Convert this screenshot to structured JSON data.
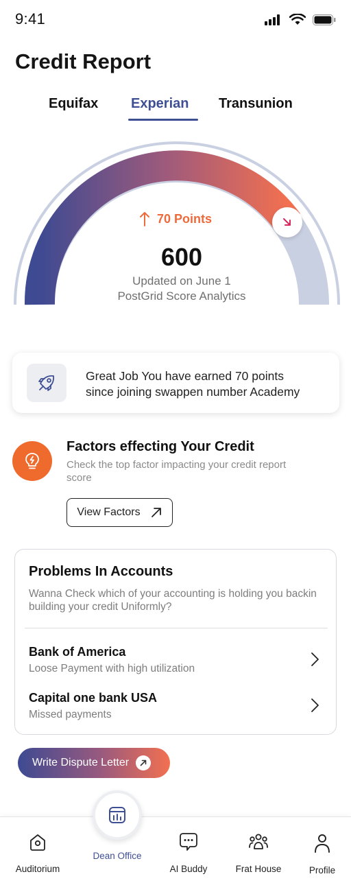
{
  "status_bar": {
    "time": "9:41"
  },
  "header": {
    "title": "Credit Report"
  },
  "tabs": [
    {
      "label": "Equifax",
      "active": false
    },
    {
      "label": "Experian",
      "active": true
    },
    {
      "label": "Transunion",
      "active": false
    }
  ],
  "gauge": {
    "points_change": "70 Points",
    "score": "600",
    "updated": "Updated on June 1",
    "provider": "PostGrid Score Analytics",
    "colors": {
      "start": "#3e4a92",
      "end": "#f27050",
      "track": "#c9d0e2"
    }
  },
  "achievement": {
    "line1": "Great Job You have earned 70 points",
    "line2": "since joining swappen number Academy",
    "icon": "rocket-icon"
  },
  "factors": {
    "title": "Factors effecting Your Credit",
    "description": "Check the top factor impacting your credit report score",
    "button_label": "View Factors",
    "icon": "lightbulb-icon"
  },
  "problems": {
    "title": "Problems In Accounts",
    "description": "Wanna Check which of your accounting is holding you backin building your credit Uniformly?",
    "accounts": [
      {
        "name": "Bank of America",
        "status": "Loose Payment with high utilization"
      },
      {
        "name": "Capital one bank USA",
        "status": "Missed payments"
      }
    ]
  },
  "dispute": {
    "label": "Write Dispute Letter"
  },
  "bottom_nav": [
    {
      "label": "Auditorium",
      "icon": "home-icon",
      "active": false
    },
    {
      "label": "Dean Office",
      "icon": "dashboard-icon",
      "active": true
    },
    {
      "label": "AI Buddy",
      "icon": "chat-icon",
      "active": false
    },
    {
      "label": "Frat House",
      "icon": "group-icon",
      "active": false
    },
    {
      "label": "Profile",
      "icon": "user-icon",
      "active": false
    }
  ],
  "colors": {
    "accent": "#3f4f94",
    "orange": "#ef6a2d"
  }
}
